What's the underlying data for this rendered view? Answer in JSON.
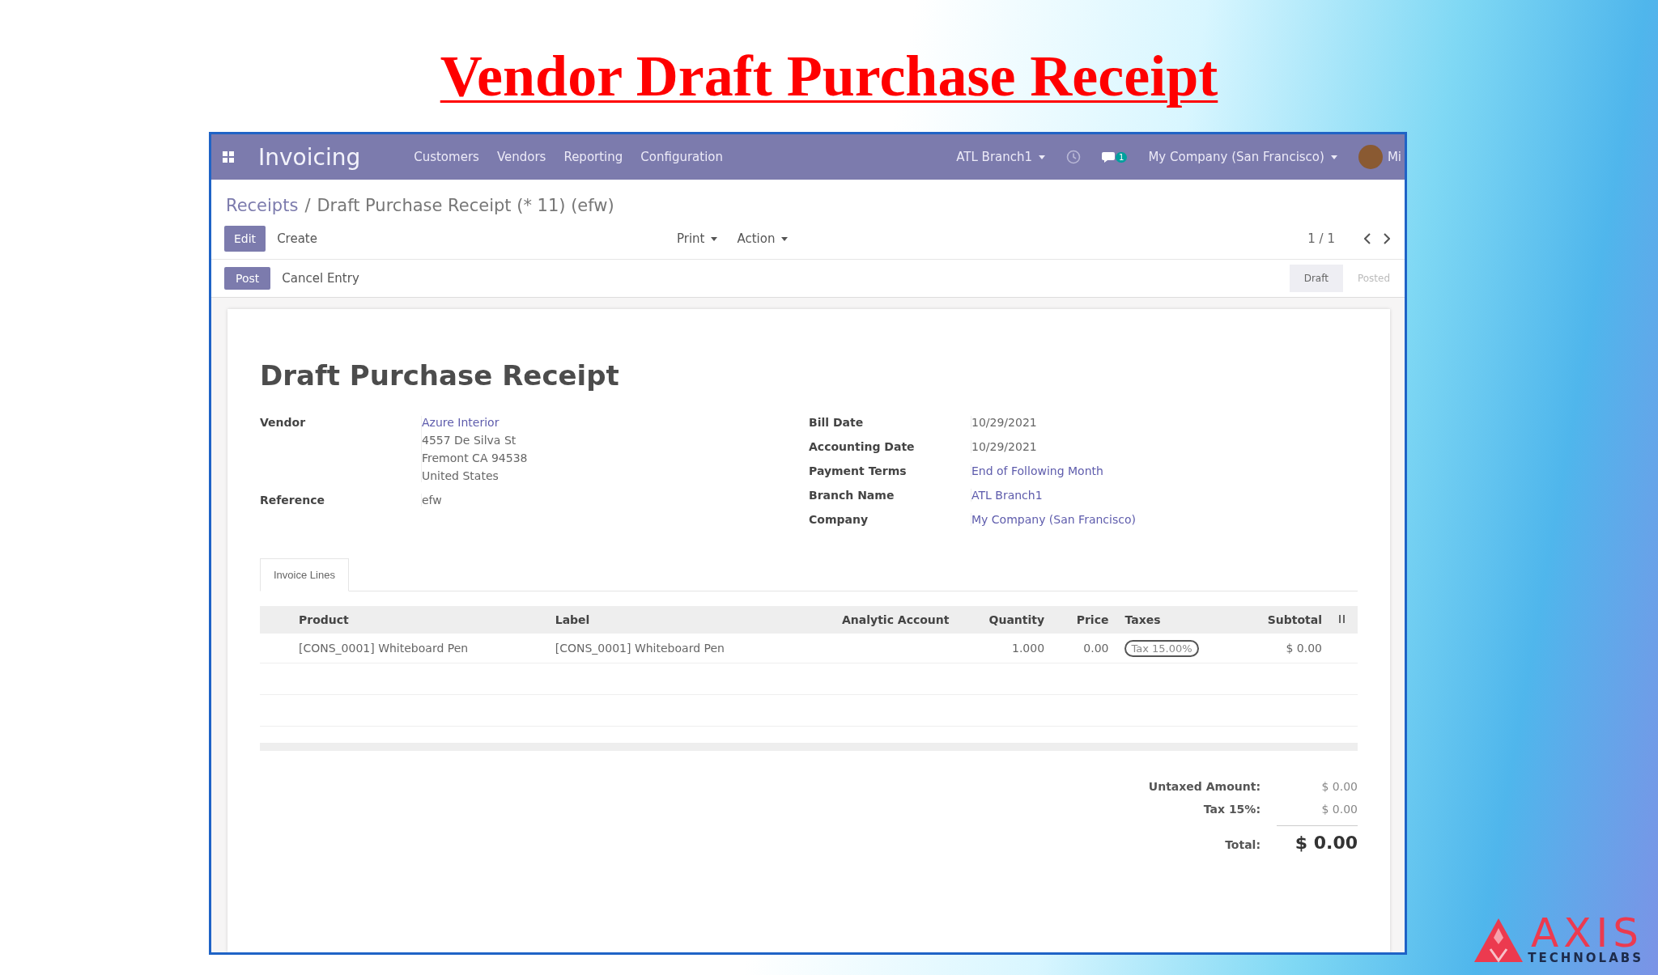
{
  "slide_title": "Vendor Draft Purchase Receipt",
  "navbar": {
    "app_name": "Invoicing",
    "menu": [
      "Customers",
      "Vendors",
      "Reporting",
      "Configuration"
    ],
    "branch": "ATL Branch1",
    "chat_badge": "1",
    "company": "My Company (San Francisco)",
    "user": "Mi"
  },
  "breadcrumb": {
    "parent": "Receipts",
    "separator": "/",
    "current": "Draft Purchase Receipt (* 11) (efw)"
  },
  "toolbar": {
    "edit": "Edit",
    "create": "Create",
    "menus": [
      "Print",
      "Action"
    ],
    "pager": "1 / 1"
  },
  "status_bar": {
    "buttons": [
      {
        "label": "Post",
        "kind": "primary"
      },
      {
        "label": "Cancel Entry",
        "kind": "secondary"
      }
    ],
    "stages": [
      {
        "label": "Draft",
        "selected": true
      },
      {
        "label": "Posted",
        "selected": false
      }
    ]
  },
  "sheet": {
    "title": "Draft Purchase Receipt",
    "left_fields": [
      {
        "label": "Vendor",
        "value": "Azure Interior",
        "link": true,
        "extra_lines": [
          "4557 De Silva St",
          "Fremont CA 94538",
          "United States"
        ]
      },
      {
        "label": "Reference",
        "value": "efw",
        "link": false
      }
    ],
    "right_fields": [
      {
        "label": "Bill Date",
        "value": "10/29/2021",
        "link": false
      },
      {
        "label": "Accounting Date",
        "value": "10/29/2021",
        "link": false
      },
      {
        "label": "Payment Terms",
        "value": "End of Following Month",
        "link": true
      },
      {
        "label": "Branch Name",
        "value": "ATL Branch1",
        "link": true
      },
      {
        "label": "Company",
        "value": "My Company (San Francisco)",
        "link": true
      }
    ],
    "tabs": [
      {
        "label": "Invoice Lines",
        "selected": true
      }
    ],
    "table": {
      "columns": [
        {
          "label": "Product",
          "numeric": false
        },
        {
          "label": "Label",
          "numeric": false
        },
        {
          "label": "Analytic Account",
          "numeric": true
        },
        {
          "label": "Quantity",
          "numeric": true
        },
        {
          "label": "Price",
          "numeric": true
        },
        {
          "label": "Taxes",
          "numeric": false
        },
        {
          "label": "Subtotal",
          "numeric": true
        }
      ],
      "rows": [
        {
          "product": "[CONS_0001] Whiteboard Pen",
          "label": "[CONS_0001] Whiteboard Pen",
          "quantity": "1.000",
          "price": "0.00",
          "taxes": [
            "Tax 15.00%"
          ],
          "subtotal": "$ 0.00"
        }
      ]
    },
    "totals": [
      {
        "label": "Untaxed Amount:",
        "value": "$ 0.00",
        "kind": "line"
      },
      {
        "label": "Tax 15%:",
        "value": "$ 0.00",
        "kind": "line"
      },
      {
        "label": "Total:",
        "value": "$ 0.00",
        "kind": "grand"
      }
    ]
  },
  "logo": {
    "name": "AXIS",
    "tagline": "TECHNOLABS"
  }
}
